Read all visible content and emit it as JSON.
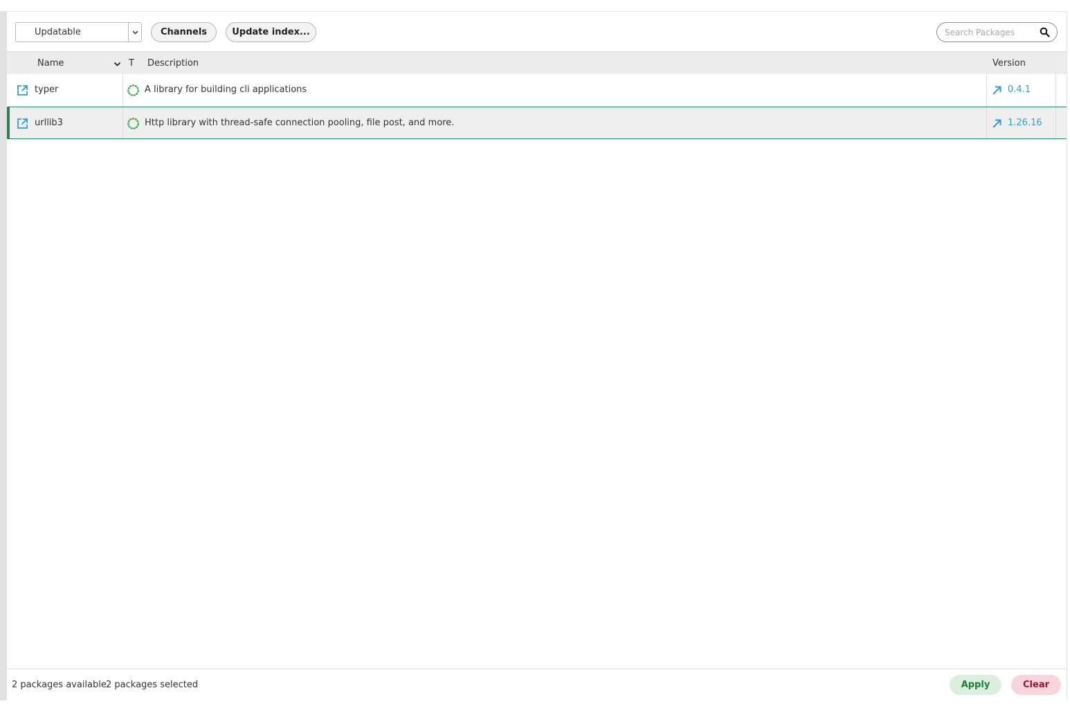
{
  "toolbar": {
    "filter_value": "Updatable",
    "channels_label": "Channels",
    "update_index_label": "Update index...",
    "search_placeholder": "Search Packages"
  },
  "table": {
    "columns": {
      "name": "Name",
      "type": "T",
      "description": "Description",
      "version": "Version"
    },
    "rows": [
      {
        "name": "typer",
        "description": "A library for building cli applications",
        "version": "0.4.1",
        "selected": false
      },
      {
        "name": "urllib3",
        "description": "Http library with thread-safe connection pooling, file post, and more.",
        "version": "1.26.16",
        "selected": true
      }
    ]
  },
  "footer": {
    "available_text": "2 packages available",
    "selected_text": "2 packages selected",
    "apply_label": "Apply",
    "clear_label": "Clear"
  },
  "colors": {
    "accent_blue": "#2b9ed8",
    "status_green": "#3aa84b",
    "selection_green": "#2e7d55",
    "apply_bg": "#dcefdf",
    "clear_bg": "#f6d5dc"
  },
  "icons": {
    "package_marked": "external-link-icon",
    "status": "spinner-ring-icon",
    "update_marker": "arrow-up-right-icon",
    "search": "search-icon",
    "dropdown": "chevron-down-icon"
  }
}
